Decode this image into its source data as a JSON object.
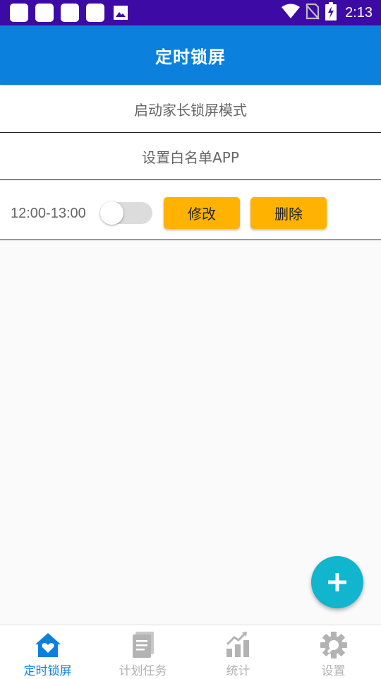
{
  "status_bar": {
    "time": "2:13",
    "icons": [
      "notification-square-icon",
      "notification-square-icon",
      "notification-square-icon",
      "notification-square-icon",
      "image-icon",
      "wifi-icon",
      "no-sim-icon",
      "battery-charging-icon"
    ]
  },
  "app_bar": {
    "title": "定时锁屏"
  },
  "menu": {
    "start_parent_lock": "启动家长锁屏模式",
    "set_whitelist": "设置白名单APP"
  },
  "schedules": [
    {
      "time": "12:00-13:00",
      "enabled": false,
      "edit_label": "修改",
      "delete_label": "删除"
    }
  ],
  "fab": {
    "icon": "plus-icon"
  },
  "bottom_nav": [
    {
      "label": "定时锁屏",
      "icon": "home-heart-icon",
      "active": true
    },
    {
      "label": "计划任务",
      "icon": "document-icon",
      "active": false
    },
    {
      "label": "统计",
      "icon": "bar-chart-icon",
      "active": false
    },
    {
      "label": "设置",
      "icon": "gear-icon",
      "active": false
    }
  ],
  "colors": {
    "status_bar": "#3d0aa6",
    "app_bar": "#0b80dd",
    "button": "#ffb300",
    "fab": "#11b5cd",
    "nav_active": "#0b80dd",
    "nav_inactive": "#b3b3b3"
  }
}
